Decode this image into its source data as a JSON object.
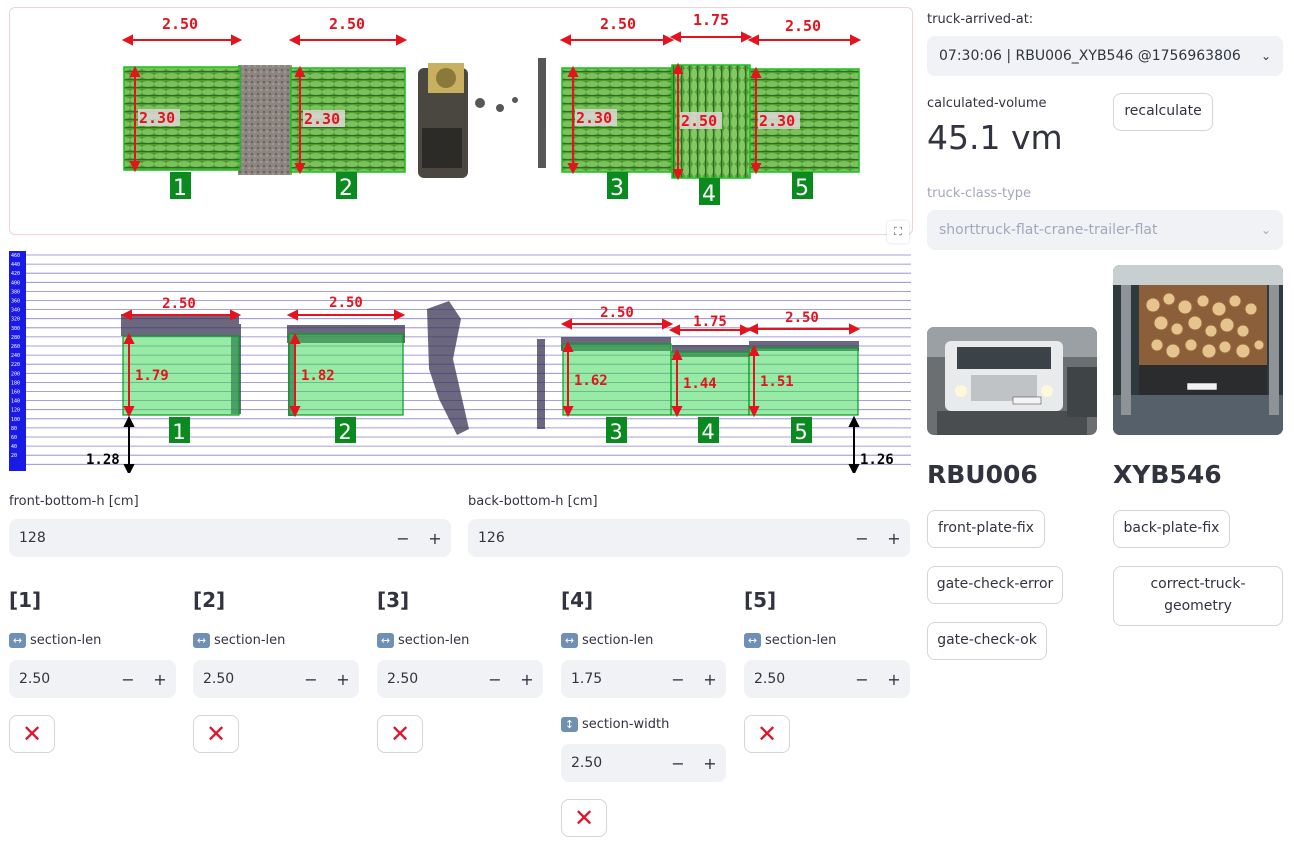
{
  "top_view": {
    "dim_labels": [
      "2.50",
      "2.50",
      "2.50",
      "1.75",
      "2.50"
    ],
    "height_labels": [
      "2.30",
      "2.30",
      "2.30",
      "2.50",
      "2.30"
    ],
    "section_numbers": [
      "1",
      "2",
      "3",
      "4",
      "5"
    ]
  },
  "side_view": {
    "dim_labels": [
      "2.50",
      "2.50",
      "2.50",
      "1.75",
      "2.50"
    ],
    "height_labels": [
      "1.79",
      "1.82",
      "1.62",
      "1.44",
      "1.51"
    ],
    "section_numbers": [
      "1",
      "2",
      "3",
      "4",
      "5"
    ],
    "front_bottom": "1.28",
    "back_bottom": "1.26",
    "scale_ticks": [
      "460",
      "440",
      "420",
      "400",
      "380",
      "360",
      "340",
      "320",
      "300",
      "280",
      "260",
      "240",
      "220",
      "200",
      "180",
      "160",
      "140",
      "120",
      "100",
      "80",
      "60",
      "40",
      "20"
    ]
  },
  "front_bottom_h": {
    "label": "front-bottom-h [cm]",
    "value": "128"
  },
  "back_bottom_h": {
    "label": "back-bottom-h [cm]",
    "value": "126"
  },
  "sections": [
    {
      "title": "[1]",
      "len_label": "section-len",
      "len_value": "2.50"
    },
    {
      "title": "[2]",
      "len_label": "section-len",
      "len_value": "2.50"
    },
    {
      "title": "[3]",
      "len_label": "section-len",
      "len_value": "2.50"
    },
    {
      "title": "[4]",
      "len_label": "section-len",
      "len_value": "1.75",
      "width_label": "section-width",
      "width_value": "2.50"
    },
    {
      "title": "[5]",
      "len_label": "section-len",
      "len_value": "2.50"
    }
  ],
  "stepper": {
    "minus": "−",
    "plus": "+"
  },
  "delete_glyph": "✕",
  "right": {
    "arrived_label": "truck-arrived-at:",
    "arrived_value": "07:30:06 | RBU006_XYB546 @1756963806",
    "volume_label": "calculated-volume",
    "volume_value": "45.1 vm",
    "recalculate": "recalculate",
    "class_label": "truck-class-type",
    "class_value": "shorttruck-flat-crane-trailer-flat",
    "front_plate": "RBU006",
    "back_plate": "XYB546",
    "front_plate_fix": "front-plate-fix",
    "back_plate_fix": "back-plate-fix",
    "gate_check_error": "gate-check-error",
    "correct_geometry": "correct-truck-geometry",
    "gate_check_ok": "gate-check-ok"
  },
  "colors": {
    "accent_red": "#e0142b",
    "load_green": "#2fb84a",
    "section_label_green": "#0a8a1f"
  }
}
